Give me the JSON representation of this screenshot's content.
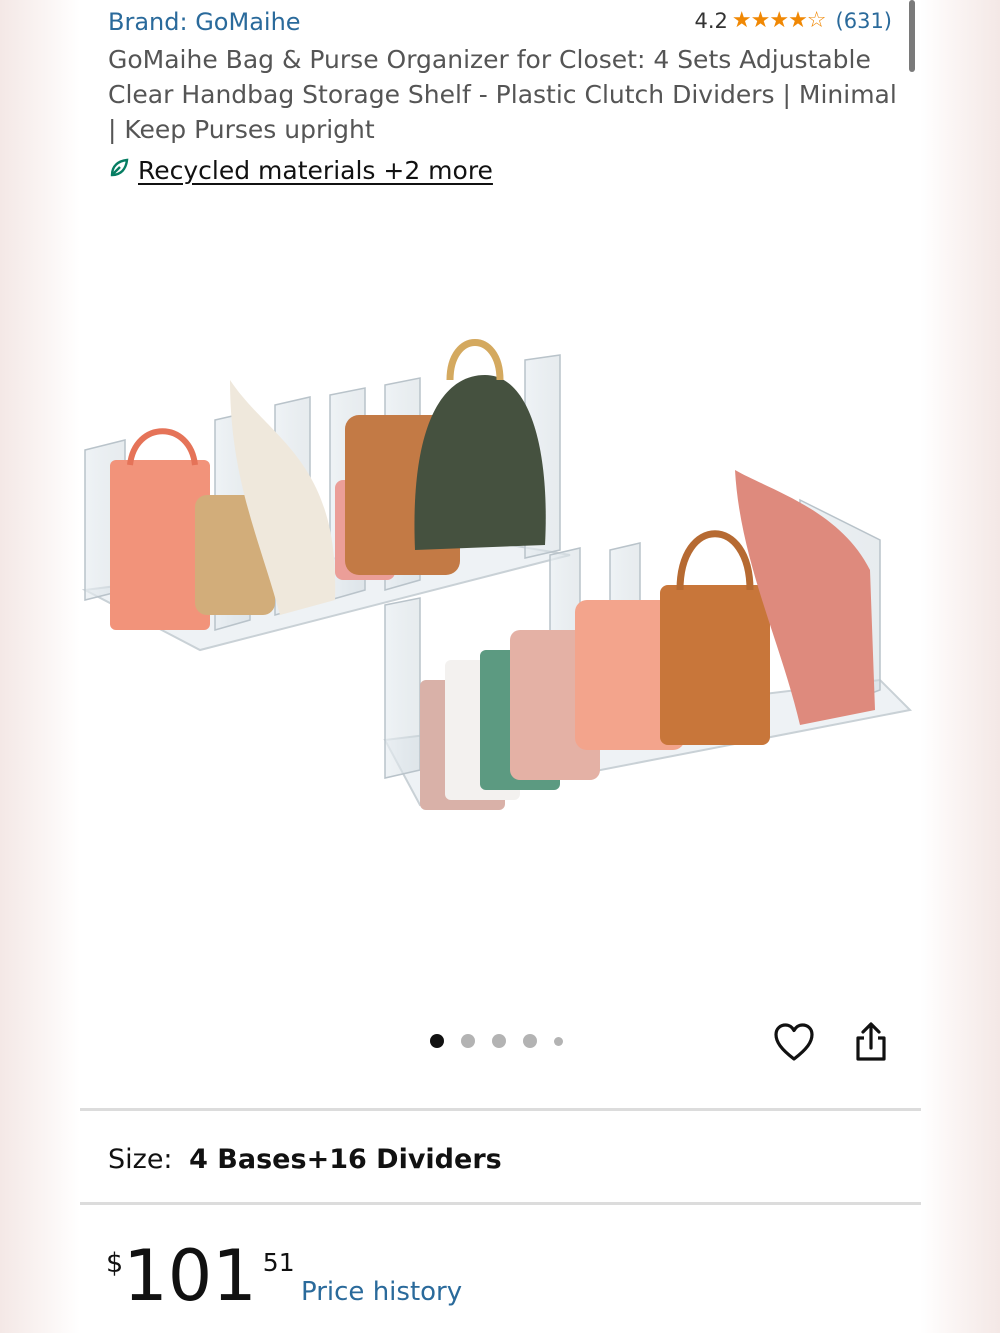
{
  "product": {
    "brand": "Brand: GoMaihe",
    "rating": "4.2",
    "stars_filled": 4,
    "stars_total": 5,
    "review_count": "(631)",
    "title": "GoMaihe Bag & Purse Organizer for Closet: 4 Sets Adjustable Clear Handbag Storage Shelf - Plastic Clutch Dividers | Minimal | Keep Purses upright",
    "sustainability_link": "Recycled materials +2 more"
  },
  "gallery": {
    "image_count": 5,
    "active_index": 0
  },
  "size": {
    "label": "Size:",
    "value": "4 Bases+16 Dividers"
  },
  "price": {
    "symbol": "$",
    "whole": "101",
    "fraction": "51",
    "history_link": "Price history"
  },
  "colors": {
    "link_blue": "#2a6a9b",
    "star_orange": "#f08804",
    "leaf_green": "#067d62"
  },
  "icons": [
    "leaf-icon",
    "heart-icon",
    "share-icon"
  ]
}
